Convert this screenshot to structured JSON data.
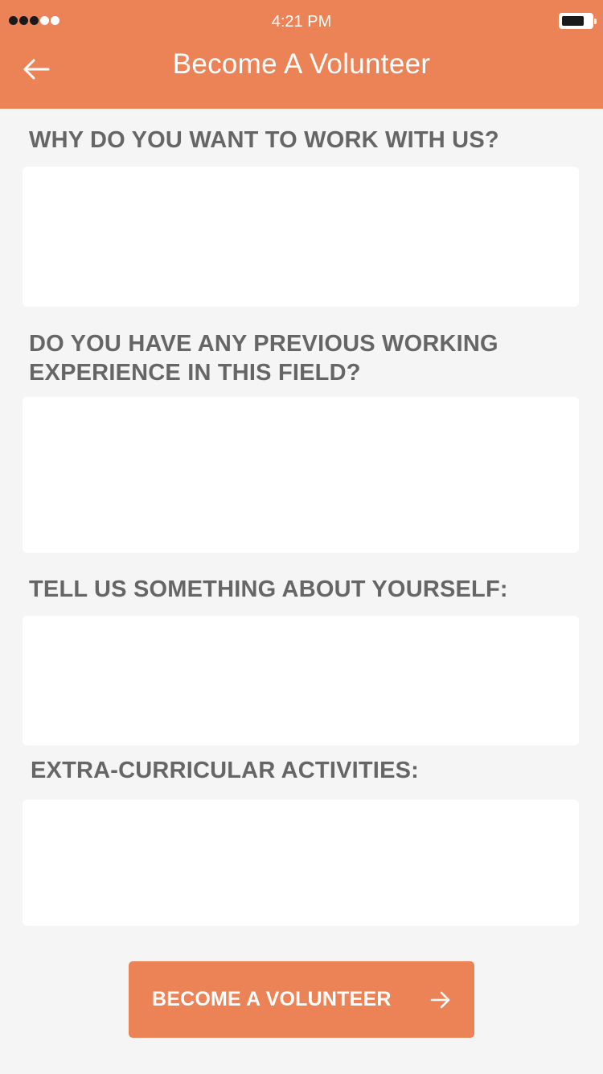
{
  "status_bar": {
    "time": "4:21 PM",
    "signal_full": 3,
    "signal_total": 5,
    "battery_level": 0.7
  },
  "header": {
    "title": "Become A Volunteer",
    "back_icon": "arrow-left-icon"
  },
  "form": {
    "q1": {
      "label": "WHY DO YOU WANT TO WORK WITH US?",
      "value": ""
    },
    "q2": {
      "label": "DO YOU HAVE ANY PREVIOUS WORKING EXPERIENCE IN THIS FIELD?",
      "value": ""
    },
    "q3": {
      "label": "TELL US SOMETHING ABOUT YOURSELF:",
      "value": ""
    },
    "q4": {
      "label": "EXTRA-CURRICULAR ACTIVITIES:",
      "value": ""
    }
  },
  "submit": {
    "label": "BECOME A VOLUNTEER",
    "icon": "arrow-right-icon"
  },
  "colors": {
    "accent": "#ec8357",
    "background": "#f5f5f5",
    "label_text": "#666666"
  }
}
